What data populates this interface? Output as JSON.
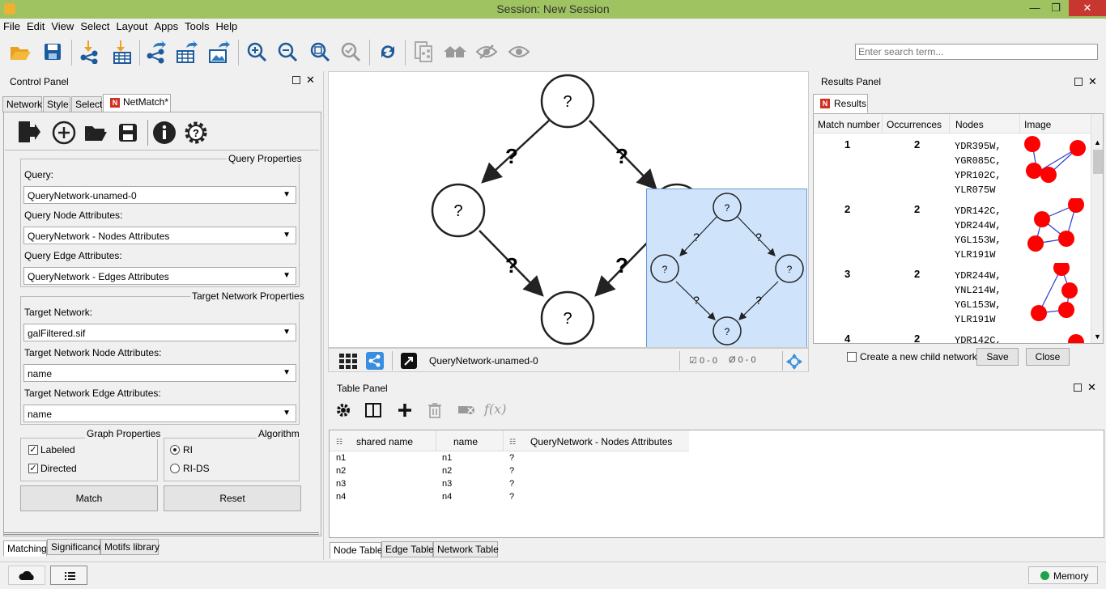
{
  "window": {
    "title": "Session: New Session"
  },
  "menu": [
    "File",
    "Edit",
    "View",
    "Select",
    "Layout",
    "Apps",
    "Tools",
    "Help"
  ],
  "search": {
    "placeholder": "Enter search term..."
  },
  "control_panel": {
    "title": "Control Panel",
    "tabs": [
      "Network",
      "Style",
      "Select",
      "NetMatch*"
    ],
    "query_properties": {
      "legend": "Query Properties",
      "query_label": "Query:",
      "query_value": "QueryNetwork-unamed-0",
      "node_attr_label": "Query Node Attributes:",
      "node_attr_value": "QueryNetwork - Nodes Attributes",
      "edge_attr_label": "Query Edge Attributes:",
      "edge_attr_value": "QueryNetwork - Edges Attributes"
    },
    "target_properties": {
      "legend": "Target Network Properties",
      "network_label": "Target Network:",
      "network_value": "galFiltered.sif",
      "node_attr_label": "Target Network Node Attributes:",
      "node_attr_value": "name",
      "edge_attr_label": "Target Network Edge Attributes:",
      "edge_attr_value": "name"
    },
    "graph_properties": {
      "legend": "Graph Properties",
      "labeled": "Labeled",
      "directed": "Directed"
    },
    "algorithm": {
      "legend": "Algorithm",
      "ri": "RI",
      "rids": "RI-DS"
    },
    "match_button": "Match",
    "reset_button": "Reset",
    "bottom_tabs": [
      "Matching",
      "Significance",
      "Motifs library"
    ]
  },
  "network_view": {
    "node_label": "?",
    "edge_label": "?",
    "network_name": "QueryNetwork-unamed-0",
    "selected_nodes": "0 - 0",
    "hidden_nodes": "0 - 0"
  },
  "results_panel": {
    "title": "Results Panel",
    "tab": "Results",
    "columns": [
      "Match number",
      "Occurrences",
      "Nodes",
      "Image"
    ],
    "rows": [
      {
        "match": "1",
        "occ": "2",
        "nodes": [
          "YDR395W,",
          "YGR085C,",
          "YPR102C,",
          "YLR075W"
        ]
      },
      {
        "match": "2",
        "occ": "2",
        "nodes": [
          "YDR142C,",
          "YDR244W,",
          "YGL153W,",
          "YLR191W"
        ]
      },
      {
        "match": "3",
        "occ": "2",
        "nodes": [
          "YDR244W,",
          "YNL214W,",
          "YGL153W,",
          "YLR191W"
        ]
      },
      {
        "match": "4",
        "occ": "2",
        "nodes": [
          "YDR142C,"
        ]
      }
    ],
    "child_network_label": "Create a new child network",
    "save_button": "Save",
    "close_button": "Close"
  },
  "table_panel": {
    "title": "Table Panel",
    "columns": [
      "shared name",
      "name",
      "QueryNetwork - Nodes Attributes"
    ],
    "rows": [
      [
        "n1",
        "n1",
        "?"
      ],
      [
        "n2",
        "n2",
        "?"
      ],
      [
        "n3",
        "n3",
        "?"
      ],
      [
        "n4",
        "n4",
        "?"
      ]
    ],
    "tabs": [
      "Node Table",
      "Edge Table",
      "Network Table"
    ]
  },
  "status": {
    "memory": "Memory"
  },
  "colors": {
    "titlebar": "#9ec360",
    "selection": "#cfe3fb",
    "result_node": "#ff0000",
    "result_edge": "#2a3bd6"
  }
}
